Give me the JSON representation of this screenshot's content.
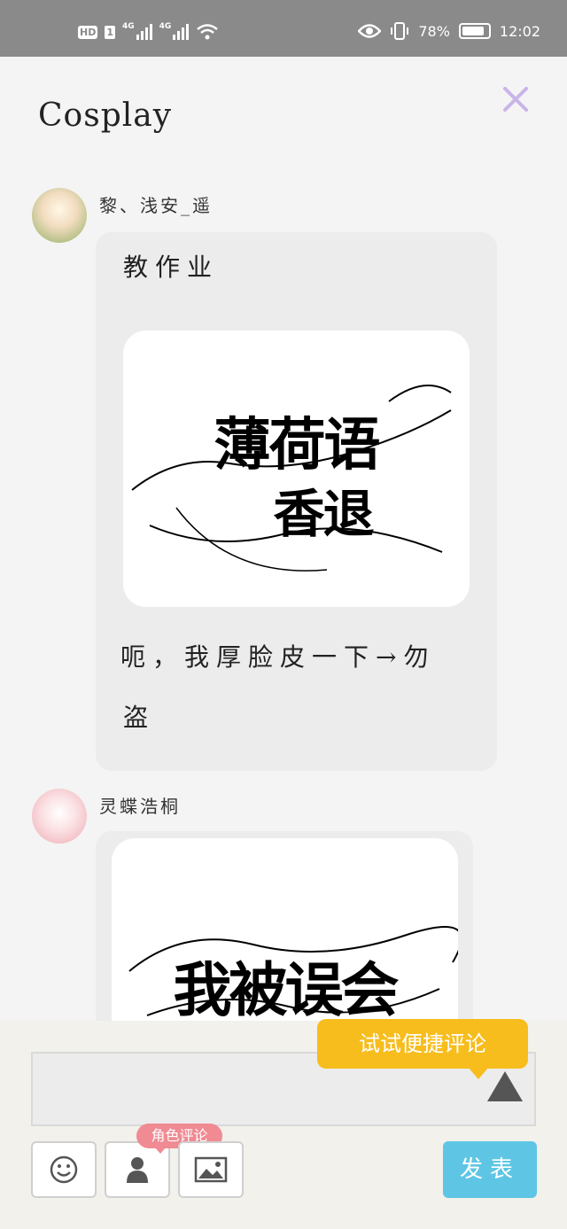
{
  "status_bar": {
    "hd": "HD",
    "sim": "1",
    "net1": "4G",
    "net2": "4G",
    "battery_pct": "78%",
    "time": "12:02",
    "icons": [
      "eye-icon",
      "vibrate-icon",
      "battery-icon",
      "wifi-icon",
      "signal-icon"
    ]
  },
  "header": {
    "title": "Cosplay",
    "close_icon": "close-icon",
    "close_color": "#c9b4ea"
  },
  "posts": [
    {
      "username": "黎、浅安_遥",
      "text_before": "教作业",
      "image_text_line1": "薄荷语",
      "image_text_line2": "香退",
      "text_after_line1": "呃，我厚脸皮一下→勿",
      "text_after_line2": "盗"
    },
    {
      "username": "灵蝶浩桐",
      "image_text_line1": "我被误会"
    }
  ],
  "composer": {
    "tip": "试试便捷评论",
    "role_badge": "角色评论",
    "post_button": "发表",
    "tool_icons": [
      "smiley-icon",
      "person-icon",
      "image-icon"
    ],
    "accent_blue": "#5ec6e4",
    "accent_yellow": "#f7bd1d",
    "accent_pink": "#f08a93"
  }
}
